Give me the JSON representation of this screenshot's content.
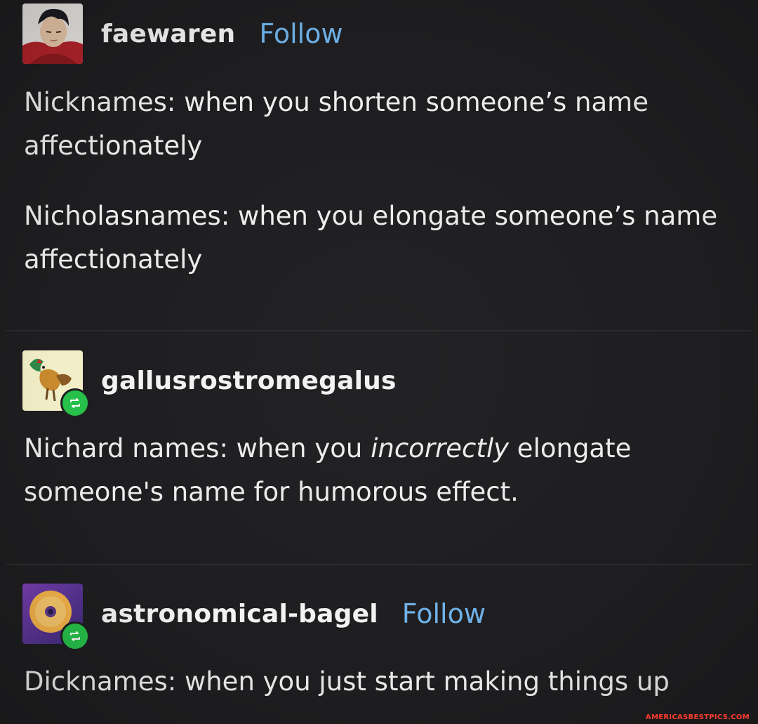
{
  "posts": [
    {
      "username": "faewaren",
      "follow_label": "Follow",
      "avatar_icon": "anime-character-avatar-icon",
      "body": [
        "Nicknames: when you shorten someone’s name affectionately",
        "Nicholasnames: when you elongate someone’s name affectionately"
      ]
    },
    {
      "username": "gallusrostromegalus",
      "avatar_icon": "rooster-avatar-icon",
      "reblog_icon": "reblog-icon",
      "body_before": "Nichard names: when you ",
      "body_emphasis": "incorrectly",
      "body_after": " elongate someone's name for humorous effect."
    },
    {
      "username": "astronomical-bagel",
      "follow_label": "Follow",
      "avatar_icon": "bagel-avatar-icon",
      "reblog_icon": "reblog-icon",
      "body": [
        "Dicknames: when you just start making things up"
      ]
    }
  ],
  "watermark": "AMERICASBESTPICS.COM",
  "colors": {
    "background": "#1e1e20",
    "text": "#ececec",
    "follow": "#6fb2e8",
    "reblog_badge": "#27c04a",
    "watermark": "#ff3b30"
  }
}
